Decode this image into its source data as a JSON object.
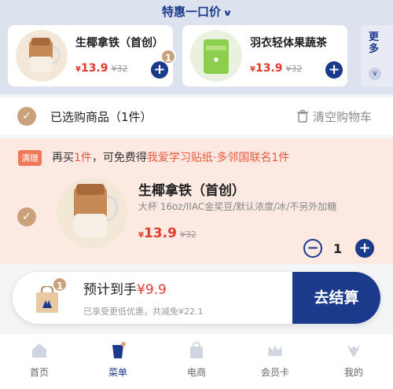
{
  "promo": {
    "title": "特惠一口价"
  },
  "promo_items": [
    {
      "name": "生椰拿铁（首创）",
      "price": "13.9",
      "currency": "¥",
      "old_price": "32",
      "count": "1"
    },
    {
      "name": "羽衣轻体果蔬茶",
      "price": "13.9",
      "currency": "¥",
      "old_price": "32"
    }
  ],
  "more": {
    "label": "更多"
  },
  "selection": {
    "label": "已选购商品（1件）",
    "clear_label": "清空购物车"
  },
  "cart_item": {
    "tag": "满赠",
    "gift_prefix": "再买",
    "gift_qty": "1件",
    "gift_mid": "，可免费得",
    "gift_item": "我爱学习贴纸·多邻国联名1件",
    "name": "生椰拿铁（首创）",
    "desc": "大杯 16oz/IIAC金奖豆/默认浓度/冰/不另外加糖",
    "currency": "¥",
    "price": "13.9",
    "old_price": "32",
    "qty": "1"
  },
  "footer": {
    "bag_count": "1",
    "estimate_label": "预计到手",
    "estimate_value": "¥9.9",
    "discount_text": "已享受更低优惠，共减免¥22.1",
    "checkout_label": "去结算"
  },
  "tabs": [
    {
      "label": "首页",
      "icon": "home-icon"
    },
    {
      "label": "菜单",
      "icon": "menu-cup-icon",
      "active": true
    },
    {
      "label": "电商",
      "icon": "shop-bag-icon"
    },
    {
      "label": "会员卡",
      "icon": "crown-icon"
    },
    {
      "label": "我的",
      "icon": "deer-icon"
    }
  ],
  "colors": {
    "brand": "#1b3a8c",
    "price": "#e23b2e",
    "accent": "#c9a27c",
    "promo_bg": "#fbe9e2"
  }
}
